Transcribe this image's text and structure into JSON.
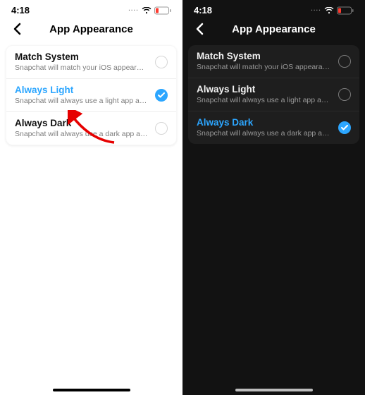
{
  "status": {
    "time": "4:18",
    "dots": "····"
  },
  "nav": {
    "title": "App Appearance"
  },
  "light": {
    "options": [
      {
        "title": "Match System",
        "desc": "Snapchat will match your iOS appearance setti…",
        "selected": false
      },
      {
        "title": "Always Light",
        "desc": "Snapchat will always use a light app appearance.",
        "selected": true
      },
      {
        "title": "Always Dark",
        "desc": "Snapchat will always use a dark app appearance.",
        "selected": false
      }
    ]
  },
  "dark": {
    "options": [
      {
        "title": "Match System",
        "desc": "Snapchat will match your iOS appearance setti…",
        "selected": false
      },
      {
        "title": "Always Light",
        "desc": "Snapchat will always use a light app appearance.",
        "selected": false
      },
      {
        "title": "Always Dark",
        "desc": "Snapchat will always use a dark app appearance.",
        "selected": true
      }
    ]
  },
  "colors": {
    "accent": "#2ca6ff",
    "battery_low": "#ff3b30"
  }
}
